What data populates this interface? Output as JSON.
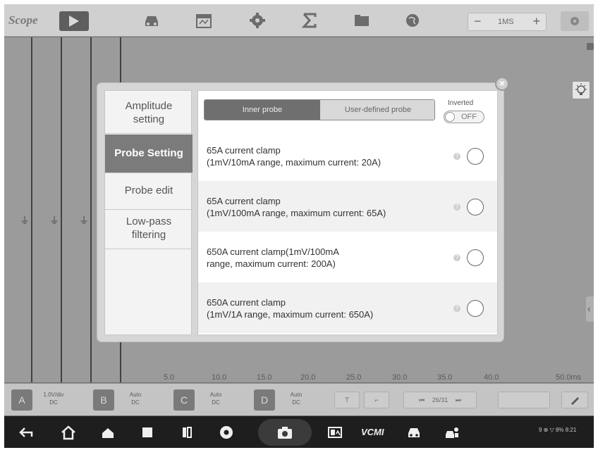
{
  "topbar": {
    "title": "Scope",
    "time_minus": "−",
    "time_value": "1MS",
    "time_plus": "+",
    "icons": [
      "play-icon",
      "car-icon",
      "calendar-icon",
      "gear-icon",
      "sigma-icon",
      "folder-icon",
      "globe-icon",
      "settings-icon"
    ]
  },
  "plot": {
    "x_labels": [
      "5.0",
      "10.0",
      "15.0",
      "20.0",
      "25.0",
      "30.0",
      "35.0",
      "40.0",
      "50.0ms"
    ]
  },
  "channels": [
    {
      "badge": "A",
      "line1": "1.0V/div",
      "line2": "DC"
    },
    {
      "badge": "B",
      "line1": "Auto",
      "line2": "DC"
    },
    {
      "badge": "C",
      "line1": "Auto",
      "line2": "DC"
    },
    {
      "badge": "D",
      "line1": "Auto",
      "line2": "DC"
    }
  ],
  "channelbar": {
    "btn_t": "T",
    "btn_edge": "⌐",
    "page": "26/31"
  },
  "navbar": {
    "vcmi": "VCMI",
    "status": "9 ⊕ ▽ 8% 8:21"
  },
  "dialog": {
    "close": "×",
    "sidebar": [
      {
        "label": "Amplitude\nsetting"
      },
      {
        "label": "Probe Setting"
      },
      {
        "label": "Probe edit"
      },
      {
        "label": "Low-pass\nfiltering"
      }
    ],
    "tabs": {
      "inner": "Inner probe",
      "user_defined": "User-defined probe"
    },
    "inverted": {
      "label": "Inverted",
      "state": "OFF"
    },
    "options": [
      {
        "text": "65A current clamp\n (1mV/10mA range, maximum current: 20A)"
      },
      {
        "text": "65A current clamp\n (1mV/100mA range, maximum current: 65A)"
      },
      {
        "text": "650A current clamp(1mV/100mA\n range, maximum current: 200A)"
      },
      {
        "text": "650A current clamp\n (1mV/1A range, maximum current: 650A)"
      }
    ]
  }
}
